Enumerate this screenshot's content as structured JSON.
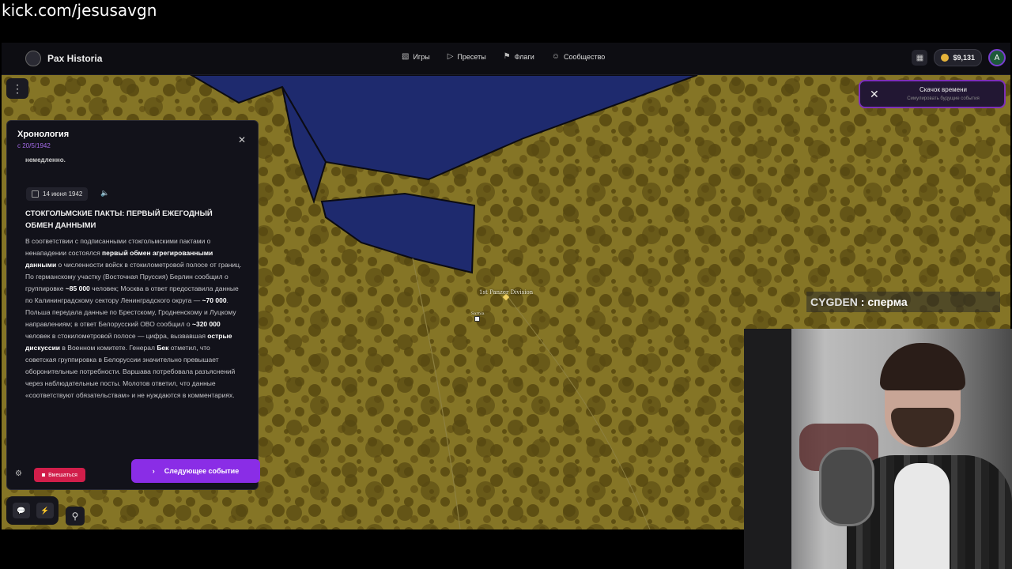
{
  "stream": {
    "url": "kick.com/jesusavgn"
  },
  "app": {
    "name": "Pax Historia",
    "nav": [
      {
        "icon": "gamepad-icon",
        "label": "Игры"
      },
      {
        "icon": "play-icon",
        "label": "Пресеты"
      },
      {
        "icon": "flag-icon",
        "label": "Флаги"
      },
      {
        "icon": "users-icon",
        "label": "Сообщество"
      }
    ],
    "balance": "$9,131",
    "avatar_letter": "A"
  },
  "time_skip": {
    "title": "Скачок времени",
    "subtitle": "Симулировать будущие события"
  },
  "chronology": {
    "title": "Хронология",
    "since": "с 20/5/1942",
    "cut_text": "немедленно.",
    "event_date": "14 июня 1942",
    "event_title": "СТОКГОЛЬМСКИЕ ПАКТЫ: ПЕРВЫЙ ЕЖЕГОДНЫЙ ОБМЕН ДАННЫМИ",
    "body": {
      "p1": "В соответствии с подписанными стокгольмскими пактами о ненападении состоялся ",
      "b1": "первый обмен агрегированными данными",
      "p2": " о численности войск в стокилометровой полосе от границ. По германскому участку (Восточная Пруссия) Берлин сообщил о группировке ",
      "b2": "~85 000",
      "p3": " человек; Москва в ответ предоставила данные по Калининградскому сектору Ленинградского округа — ",
      "b3": "~70 000",
      "p4": ". Польша передала данные по Брестскому, Гродненскому и Луцкому направлениям; в ответ Белорусский ОВО сообщил о ",
      "b4": "~320 000",
      "p5": " человек в стокилометровой полосе — цифра, вызвавшая ",
      "b5": "острые дискуссии",
      "p6": " в Военном комитете. Генерал ",
      "b6": "Бек",
      "p7": " отметил, что советская группировка в Белоруссии значительно превышает оборонительные потребности. Варшава потребовала разъяснений через наблюдательные посты. Молотов ответил, что данные «соответствуют обязательствам» и не нуждаются в комментариях."
    },
    "intervene_label": "Вмешаться",
    "next_label": "Следующее событие"
  },
  "map": {
    "unit_label": "1st Panzer Division",
    "city_label": "Sarnia",
    "colors": {
      "land": "#857526",
      "land_dark": "#5e4f13",
      "water": "#1e2a6e"
    }
  },
  "chat": {
    "user": "CYGDEN",
    "separator": " : ",
    "message": "сперма"
  }
}
